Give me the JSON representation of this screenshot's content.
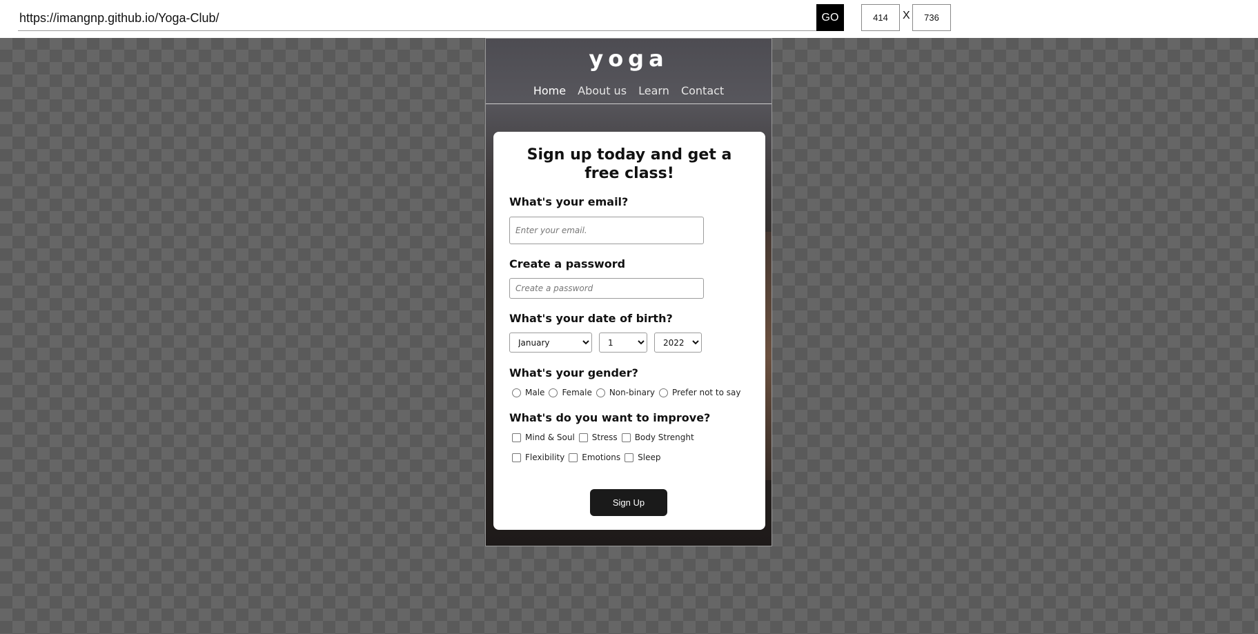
{
  "toolbar": {
    "url": "https://imangnp.github.io/Yoga-Club/",
    "go_label": "GO",
    "width_value": "414",
    "separator": "X",
    "height_value": "736"
  },
  "site": {
    "logo": "yoga",
    "nav": [
      "Home",
      "About us",
      "Learn",
      "Contact"
    ]
  },
  "form": {
    "title": "Sign up today and get a free class!",
    "email_label": "What's your email?",
    "email_placeholder": "Enter your email.",
    "password_label": "Create a password",
    "password_placeholder": "Create a password",
    "dob_label": "What's your date of birth?",
    "dob_month": "January",
    "dob_day": "1",
    "dob_year": "2022",
    "gender_label": "What's your gender?",
    "gender_options": [
      "Male",
      "Female",
      "Non-binary",
      "Prefer not to say"
    ],
    "improve_label": "What's do you want to improve?",
    "improve_row1": [
      "Mind & Soul",
      "Stress",
      "Body Strenght"
    ],
    "improve_row2": [
      "Flexibility",
      "Emotions",
      "Sleep"
    ],
    "submit_label": "Sign Up"
  }
}
